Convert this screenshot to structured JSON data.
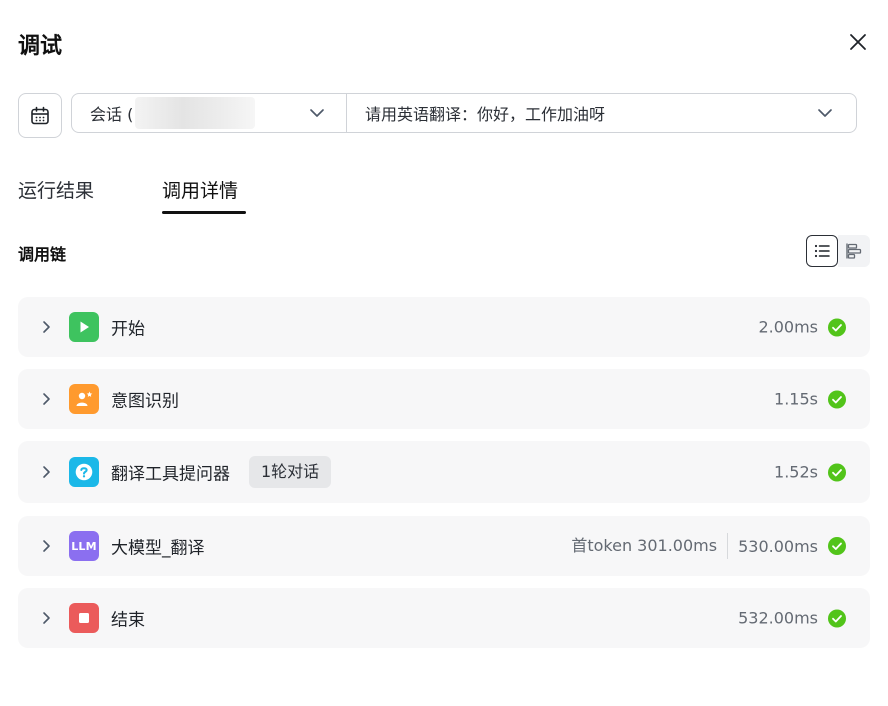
{
  "header": {
    "title": "调试"
  },
  "session": {
    "label": "会话 (",
    "query": "请用英语翻译：你好，工作加油呀"
  },
  "tabs": [
    {
      "label": "运行结果",
      "active": false
    },
    {
      "label": "调用详情",
      "active": true
    }
  ],
  "chain": {
    "title": "调用链",
    "view_modes": [
      "list-view",
      "timeline-view"
    ],
    "nodes": [
      {
        "name": "开始",
        "icon": "play-icon",
        "color": "#3ec35f",
        "duration": "2.00ms",
        "status": "success"
      },
      {
        "name": "意图识别",
        "icon": "user-star-icon",
        "color": "#ff9a2e",
        "duration": "1.15s",
        "status": "success"
      },
      {
        "name": "翻译工具提问器",
        "icon": "question-icon",
        "color": "#1bb8e8",
        "badge": "1轮对话",
        "duration": "1.52s",
        "status": "success"
      },
      {
        "name": "大模型_翻译",
        "icon": "llm-icon",
        "icon_text": "LLM",
        "color": "#8b6ff0",
        "first_token": "首token 301.00ms",
        "duration": "530.00ms",
        "status": "success"
      },
      {
        "name": "结束",
        "icon": "stop-icon",
        "color": "#eb5b5b",
        "duration": "532.00ms",
        "status": "success"
      }
    ]
  },
  "colors": {
    "success": "#52c41a",
    "tab_active": "#111111"
  }
}
